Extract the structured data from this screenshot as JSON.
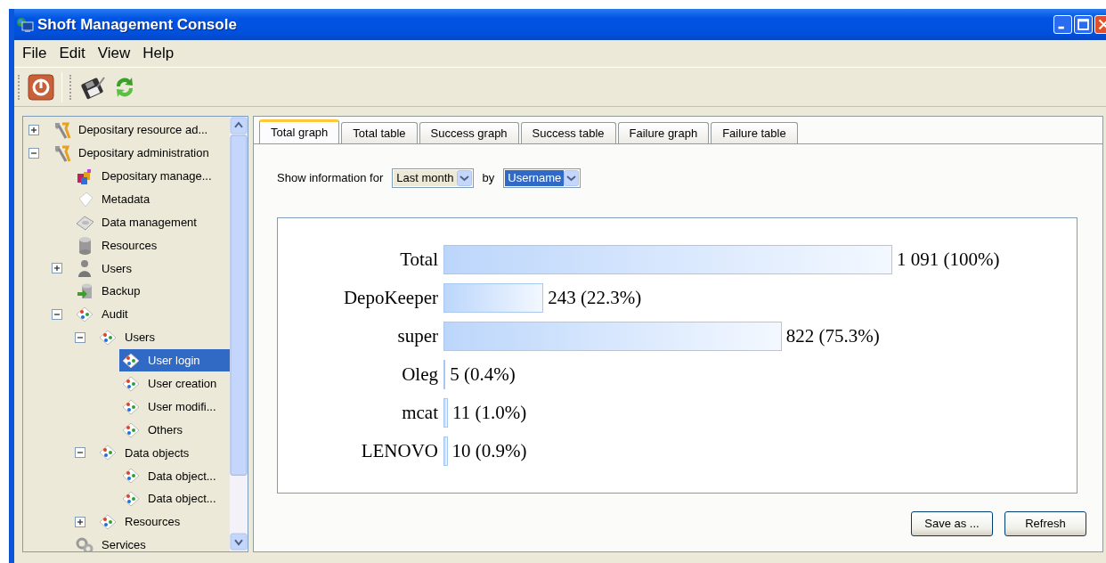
{
  "window": {
    "title": "Shoft Management Console"
  },
  "menu": [
    "File",
    "Edit",
    "View",
    "Help"
  ],
  "tree": {
    "items": [
      {
        "label": "Depositary resource ad...",
        "kind": "tools",
        "expanded": false,
        "selected": false
      },
      {
        "label": "Depositary administration",
        "kind": "tools",
        "expanded": true,
        "selected": false,
        "children": [
          {
            "label": "Depositary manage...",
            "kind": "blocks",
            "selected": false
          },
          {
            "label": "Metadata",
            "kind": "page",
            "selected": false
          },
          {
            "label": "Data management",
            "kind": "disk",
            "selected": false
          },
          {
            "label": "Resources",
            "kind": "database",
            "selected": false
          },
          {
            "label": "Users",
            "kind": "user",
            "expanded": false,
            "selected": false
          },
          {
            "label": "Backup",
            "kind": "backup",
            "selected": false
          },
          {
            "label": "Audit",
            "kind": "diagram",
            "expanded": true,
            "selected": false,
            "children": [
              {
                "label": "Users",
                "kind": "diagram",
                "expanded": true,
                "selected": false,
                "children": [
                  {
                    "label": "User login",
                    "kind": "diagram",
                    "selected": true
                  },
                  {
                    "label": "User creation",
                    "kind": "diagram",
                    "selected": false
                  },
                  {
                    "label": "User modifi...",
                    "kind": "diagram",
                    "selected": false
                  },
                  {
                    "label": "Others",
                    "kind": "diagram",
                    "selected": false
                  }
                ]
              },
              {
                "label": "Data objects",
                "kind": "diagram",
                "expanded": true,
                "selected": false,
                "children": [
                  {
                    "label": "Data object...",
                    "kind": "diagram",
                    "selected": false
                  },
                  {
                    "label": "Data object...",
                    "kind": "diagram",
                    "selected": false
                  }
                ]
              },
              {
                "label": "Resources",
                "kind": "diagram",
                "expanded": false,
                "selected": false
              }
            ]
          },
          {
            "label": "Services",
            "kind": "gears",
            "selected": false
          }
        ]
      }
    ]
  },
  "tabs": [
    {
      "label": "Total graph",
      "selected": true
    },
    {
      "label": "Total table",
      "selected": false
    },
    {
      "label": "Success graph",
      "selected": false
    },
    {
      "label": "Success table",
      "selected": false
    },
    {
      "label": "Failure graph",
      "selected": false
    },
    {
      "label": "Failure table",
      "selected": false
    }
  ],
  "filter": {
    "label": "Show information for",
    "period": {
      "value": "Last month",
      "focused": false
    },
    "by_label": "by",
    "group": {
      "value": "Username",
      "focused": true
    }
  },
  "chart": {
    "chart_data": {
      "type": "bar",
      "orientation": "horizontal",
      "categories": [
        "Total",
        "DepoKeeper",
        "super",
        "Oleg",
        "mcat",
        "LENOVO"
      ],
      "values": [
        1091,
        243,
        822,
        5,
        11,
        10
      ],
      "value_labels": [
        "1 091 (100%)",
        "243 (22.3%)",
        "822 (75.3%)",
        "5 (0.4%)",
        "11 (1.0%)",
        "10 (0.9%)"
      ]
    }
  },
  "buttons": [
    "Save as ...",
    "Refresh"
  ]
}
